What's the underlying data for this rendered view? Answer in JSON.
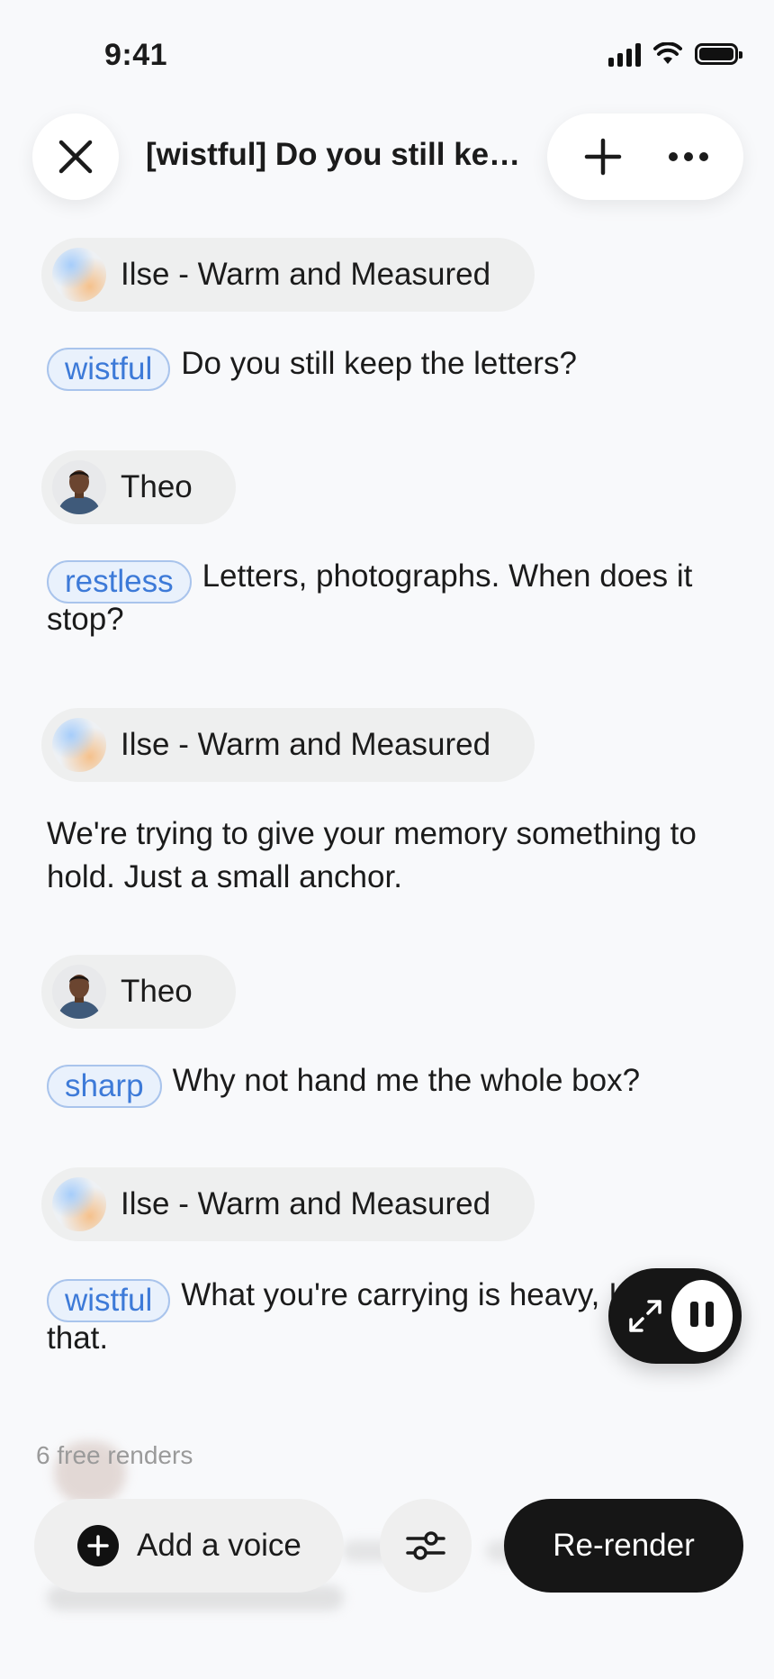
{
  "status_bar": {
    "time": "9:41"
  },
  "header": {
    "title": "[wistful] Do you still kee...",
    "close_icon": "close-icon",
    "add_icon": "plus-icon",
    "more_icon": "more-icon"
  },
  "dialogue": [
    {
      "speaker": "Ilse - Warm and Measured",
      "tag": "wistful",
      "text": "Do you still keep the letters?"
    },
    {
      "speaker": "Theo",
      "tag": "restless",
      "text": "Letters, photographs. When does it stop?"
    },
    {
      "speaker": "Ilse - Warm and Measured",
      "tag": "",
      "text": "We're trying to give your memory something to hold. Just a small anchor."
    },
    {
      "speaker": "Theo",
      "tag": "sharp",
      "text": "Why not hand me the whole box?"
    },
    {
      "speaker": "Ilse - Warm and Measured",
      "tag": "wistful",
      "text": "What you're carrying is heavy, I know that."
    }
  ],
  "player": {
    "expand_icon": "expand-icon",
    "pause_icon": "pause-icon"
  },
  "footer": {
    "free_renders": "6 free renders",
    "add_voice_label": "Add a voice",
    "settings_icon": "sliders-icon",
    "rerender_label": "Re-render"
  },
  "colors": {
    "tag_text": "#3d7ad8",
    "tag_bg": "#e9f1fc",
    "primary_button": "#161616",
    "background": "#f8f9fb"
  }
}
